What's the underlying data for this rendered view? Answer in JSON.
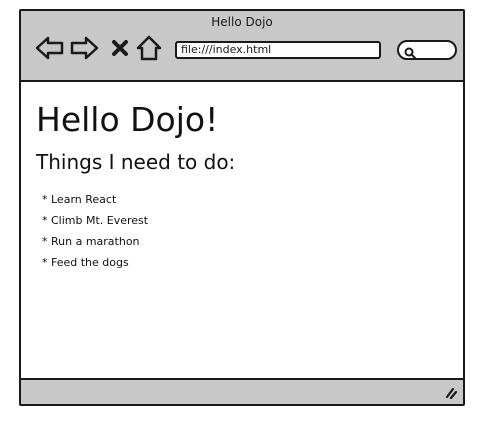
{
  "window": {
    "title": "Hello Dojo"
  },
  "toolbar": {
    "back_icon": "arrow-left-icon",
    "forward_icon": "arrow-right-icon",
    "stop_icon": "close-icon",
    "home_icon": "home-icon",
    "address_value": "file:///index.html",
    "search_icon": "search-icon"
  },
  "page": {
    "heading": "Hello Dojo!",
    "subheading": "Things I need to do:",
    "todos": [
      "* Learn React",
      "* Climb Mt. Everest",
      "* Run a marathon",
      "* Feed the dogs"
    ]
  },
  "statusbar": {
    "grip_icon": "resize-grip-icon"
  },
  "colors": {
    "chrome": "#c8c8c8",
    "border": "#1a1a1a",
    "page_bg": "#ffffff"
  }
}
